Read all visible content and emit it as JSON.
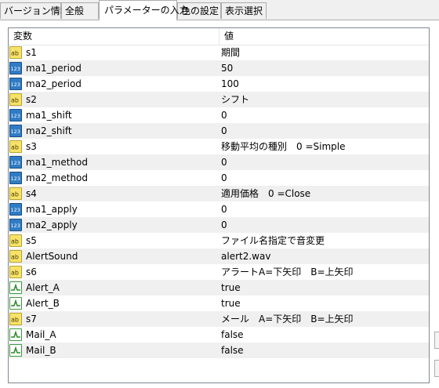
{
  "tabs": [
    {
      "label": "バージョン情報",
      "active": false
    },
    {
      "label": "全般",
      "active": false
    },
    {
      "label": "パラメーターの入力",
      "active": true
    },
    {
      "label": "色の設定",
      "active": false
    },
    {
      "label": "表示選択",
      "active": false
    }
  ],
  "table": {
    "headers": {
      "variable": "変数",
      "value": "値"
    },
    "rows": [
      {
        "type": "string",
        "icon": "ab-string-icon",
        "name": "s1",
        "value": "期間"
      },
      {
        "type": "int",
        "icon": "123-int-icon",
        "name": "ma1_period",
        "value": "50"
      },
      {
        "type": "int",
        "icon": "123-int-icon",
        "name": "ma2_period",
        "value": "100"
      },
      {
        "type": "string",
        "icon": "ab-string-icon",
        "name": "s2",
        "value": "シフト"
      },
      {
        "type": "int",
        "icon": "123-int-icon",
        "name": "ma1_shift",
        "value": "0"
      },
      {
        "type": "int",
        "icon": "123-int-icon",
        "name": "ma2_shift",
        "value": "0"
      },
      {
        "type": "string",
        "icon": "ab-string-icon",
        "name": "s3",
        "value": "移動平均の種別　0 =Simple"
      },
      {
        "type": "int",
        "icon": "123-int-icon",
        "name": "ma1_method",
        "value": "0"
      },
      {
        "type": "int",
        "icon": "123-int-icon",
        "name": "ma2_method",
        "value": "0"
      },
      {
        "type": "string",
        "icon": "ab-string-icon",
        "name": "s4",
        "value": "適用価格　0 =Close"
      },
      {
        "type": "int",
        "icon": "123-int-icon",
        "name": "ma1_apply",
        "value": "0"
      },
      {
        "type": "int",
        "icon": "123-int-icon",
        "name": "ma2_apply",
        "value": "0"
      },
      {
        "type": "string",
        "icon": "ab-string-icon",
        "name": "s5",
        "value": "ファイル名指定で音変更"
      },
      {
        "type": "string",
        "icon": "ab-string-icon",
        "name": "AlertSound",
        "value": "alert2.wav"
      },
      {
        "type": "string",
        "icon": "ab-string-icon",
        "name": "s6",
        "value": "アラートA=下矢印　B=上矢印"
      },
      {
        "type": "bool",
        "icon": "bool-icon",
        "name": "Alert_A",
        "value": "true"
      },
      {
        "type": "bool",
        "icon": "bool-icon",
        "name": "Alert_B",
        "value": "true"
      },
      {
        "type": "string",
        "icon": "ab-string-icon",
        "name": "s7",
        "value": "メール　A=下矢印　B=上矢印"
      },
      {
        "type": "bool",
        "icon": "bool-icon",
        "name": "Mail_A",
        "value": "false"
      },
      {
        "type": "bool",
        "icon": "bool-icon",
        "name": "Mail_B",
        "value": "false"
      }
    ]
  }
}
